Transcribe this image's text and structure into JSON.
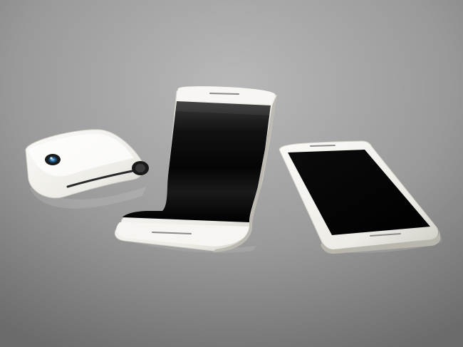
{
  "scene": {
    "colors": {
      "background_center": "#b3b3b3",
      "background_edge": "#6f6f6f",
      "device_body": "#f1f0ec",
      "device_shadow": "#c9c7c0",
      "screen": "#050505",
      "camera_lens": "#3f7fb0"
    },
    "objects": [
      {
        "name": "folded-phone-closed",
        "description_icon": "folded-device-icon"
      },
      {
        "name": "folded-phone-bent",
        "description_icon": "bent-device-icon"
      },
      {
        "name": "flat-phone",
        "description_icon": "flat-device-icon"
      }
    ]
  }
}
